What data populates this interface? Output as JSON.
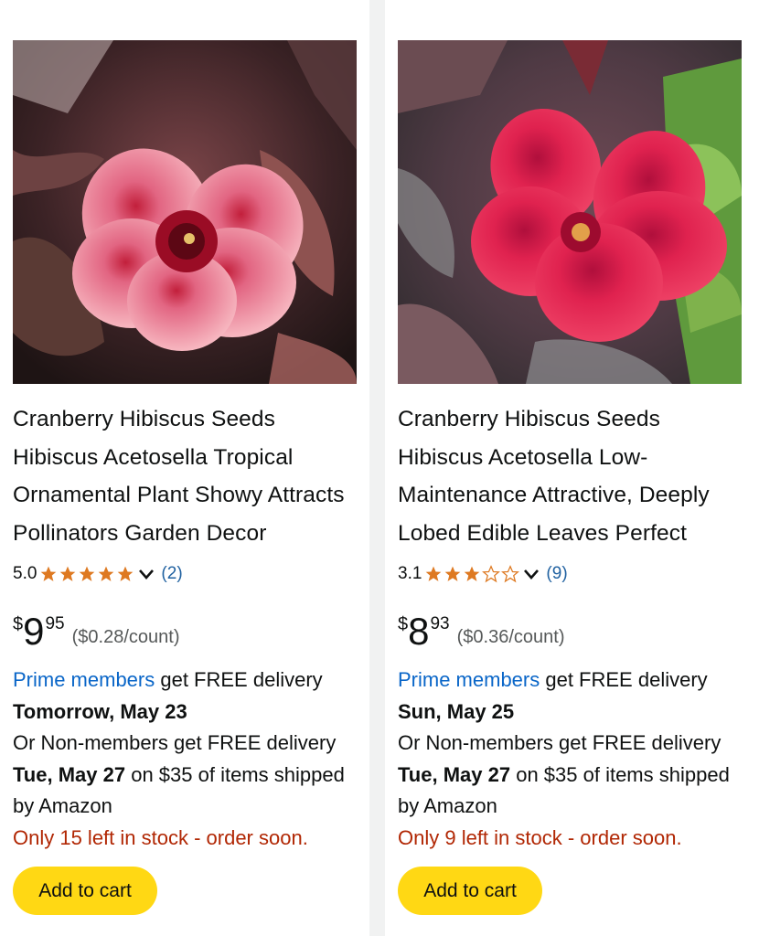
{
  "products": [
    {
      "title": "Cranberry Hibiscus Seeds Hibiscus Acetosella Tropical Ornamental Plant Showy Attracts Pollinators Garden Decor",
      "image_alt": "pink-hibiscus-flower",
      "rating_value": "5.0",
      "rating_fraction": 1.0,
      "stars_filled": 5,
      "review_count": "(2)",
      "price_symbol": "$",
      "price_whole": "9",
      "price_fraction": "95",
      "unit_price": "($0.28/count)",
      "prime_link": "Prime members",
      "prime_text": " get FREE delivery",
      "prime_date": "Tomorrow, May 23",
      "nonmember_prefix": "Or Non-members get FREE delivery ",
      "nonmember_date": "Tue, May 27",
      "nonmember_suffix": " on $35 of items shipped by Amazon",
      "stock": "Only 15 left in stock - order soon.",
      "button": "Add to cart"
    },
    {
      "title": "Cranberry Hibiscus Seeds Hibiscus Acetosella Low-Maintenance Attractive, Deeply Lobed Edible Leaves Perfect",
      "image_alt": "red-hibiscus-flower",
      "rating_value": "3.1",
      "rating_fraction": 0.62,
      "stars_filled": 3,
      "review_count": "(9)",
      "price_symbol": "$",
      "price_whole": "8",
      "price_fraction": "93",
      "unit_price": "($0.36/count)",
      "prime_link": "Prime members",
      "prime_text": " get FREE delivery",
      "prime_date": "Sun, May 25",
      "nonmember_prefix": "Or Non-members get FREE delivery ",
      "nonmember_date": "Tue, May 27",
      "nonmember_suffix": " on $35 of items shipped by Amazon",
      "stock": "Only 9 left in stock - order soon.",
      "button": "Add to cart"
    }
  ],
  "colors": {
    "star": "#de7921",
    "link": "#0a66c8",
    "stock": "#b12704",
    "button": "#ffd814"
  },
  "icons": [
    "star-icon",
    "chevron-down-icon"
  ]
}
